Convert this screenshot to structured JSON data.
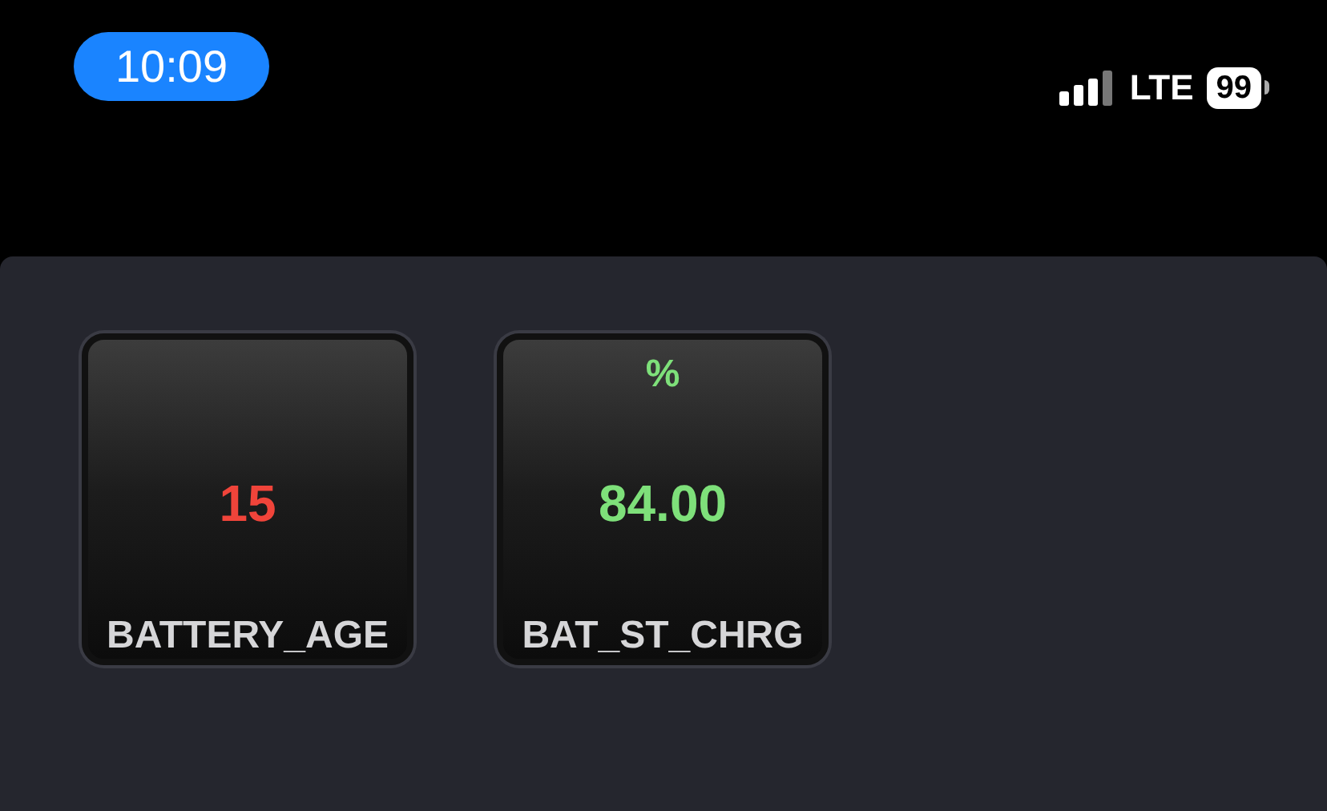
{
  "status_bar": {
    "time": "10:09",
    "network": "LTE",
    "battery": "99"
  },
  "tiles": [
    {
      "label": "BATTERY_AGE",
      "value": "15",
      "color": "#f0443a"
    },
    {
      "label": "BAT_ST_CHRG",
      "unit": "%",
      "value": "84.00",
      "color": "#7ee07a"
    }
  ]
}
